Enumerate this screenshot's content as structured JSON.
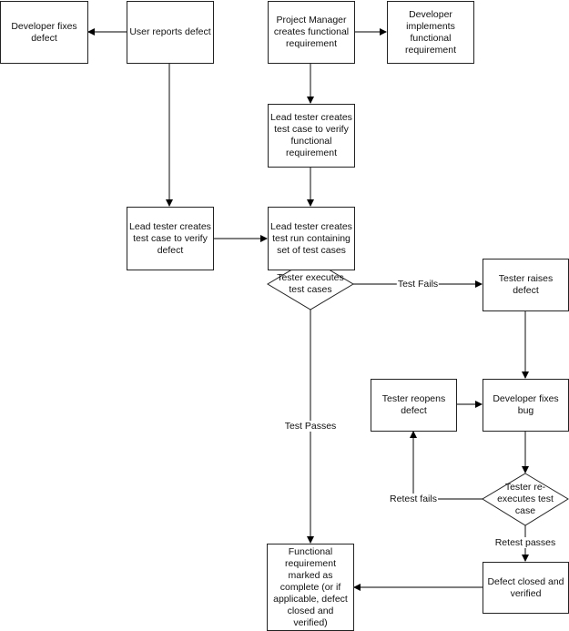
{
  "nodes": {
    "dev_fixes_defect": "Developer fixes defect",
    "user_reports_defect": "User reports defect",
    "pm_creates_req": "Project Manager creates functional requirement",
    "dev_implements_req": "Developer implements functional requirement",
    "lead_test_case_req": "Lead tester creates test case to verify functional requirement",
    "lead_test_case_defect": "Lead tester creates test case to verify defect",
    "lead_test_run": "Lead tester creates test run containing set of test cases",
    "tester_executes": "Tester executes test cases",
    "tester_raises_defect": "Tester raises defect",
    "tester_reopens_defect": "Tester reopens defect",
    "dev_fixes_bug": "Developer fixes bug",
    "tester_reexecutes": "Tester re-executes test case",
    "defect_closed": "Defect closed and verified",
    "req_complete": "Functional requirement marked as complete (or if applicable, defect closed and verified)"
  },
  "edge_labels": {
    "test_fails": "Test Fails",
    "test_passes": "Test Passes",
    "retest_fails": "Retest fails",
    "retest_passes": "Retest passes"
  }
}
